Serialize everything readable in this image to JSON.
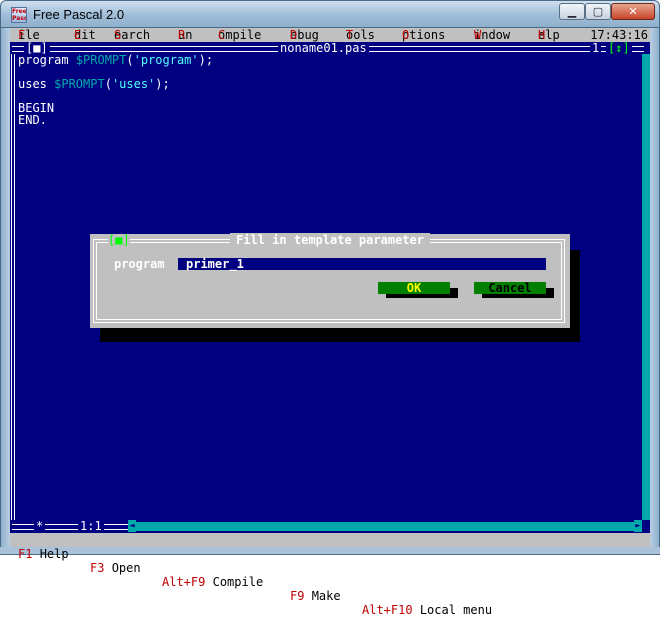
{
  "window": {
    "title": "Free Pascal 2.0",
    "icon_text": "Free Pascal"
  },
  "menu": {
    "items": [
      {
        "label": "File",
        "hot": "F"
      },
      {
        "label": "Edit",
        "hot": "E"
      },
      {
        "label": "Search",
        "hot": "S"
      },
      {
        "label": "Run",
        "hot": "R"
      },
      {
        "label": "Compile",
        "hot": "C"
      },
      {
        "label": "Debug",
        "hot": "D"
      },
      {
        "label": "Tools",
        "hot": "T"
      },
      {
        "label": "Options",
        "hot": "O"
      },
      {
        "label": "Window",
        "hot": "W"
      },
      {
        "label": "Help",
        "hot": "H"
      }
    ],
    "clock": "17:43:16"
  },
  "editor": {
    "close_marker": "[■]",
    "filename": "noname01.pas",
    "window_number": "1",
    "zoom_marker": "[↕]",
    "lines": [
      {
        "a": "program ",
        "b": "$PROMPT",
        "c": "(",
        "d": "'program'",
        "e": ");"
      },
      {
        "a": "uses ",
        "b": "$PROMPT",
        "c": "(",
        "d": "'uses'",
        "e": ");"
      },
      {
        "a": "BEGIN"
      },
      {
        "a": "END."
      }
    ],
    "position": "1:1",
    "modified_marker": "*"
  },
  "dialog": {
    "title": "Fill in template parameter",
    "close_marker": "[■]",
    "param_label": "program",
    "param_value": "primer_1",
    "ok_label": "OK",
    "cancel_label": "Cancel"
  },
  "status": {
    "items": [
      {
        "key": "F1",
        "label": "Help"
      },
      {
        "key": "F3",
        "label": "Open"
      },
      {
        "key": "Alt+F9",
        "label": "Compile"
      },
      {
        "key": "F9",
        "label": "Make"
      },
      {
        "key": "Alt+F10",
        "label": "Local menu"
      }
    ]
  },
  "colors": {
    "desktop": "#000080",
    "menu": "#c0c0c0",
    "hotkey": "#c00000",
    "button": "#008000",
    "scrollbar": "#00aaaa"
  }
}
